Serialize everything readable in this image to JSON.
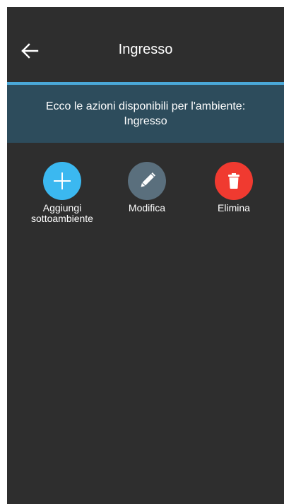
{
  "header": {
    "title": "Ingresso",
    "back_icon": "arrow-left-icon"
  },
  "banner": {
    "line1": "Ecco le azioni disponibili per l'ambiente:",
    "line2": "Ingresso"
  },
  "actions": [
    {
      "label_line1": "Aggiungi",
      "label_line2": "sottoambiente",
      "icon": "plus-icon",
      "color": "#3bb8f0"
    },
    {
      "label_line1": "Modifica",
      "label_line2": "",
      "icon": "pencil-icon",
      "color": "#5a6f7d"
    },
    {
      "label_line1": "Elimina",
      "label_line2": "",
      "icon": "trash-icon",
      "color": "#f03a30"
    }
  ],
  "colors": {
    "background": "#2e2e2e",
    "accent_line": "#4aa8d8",
    "banner": "#2d4c5c"
  }
}
